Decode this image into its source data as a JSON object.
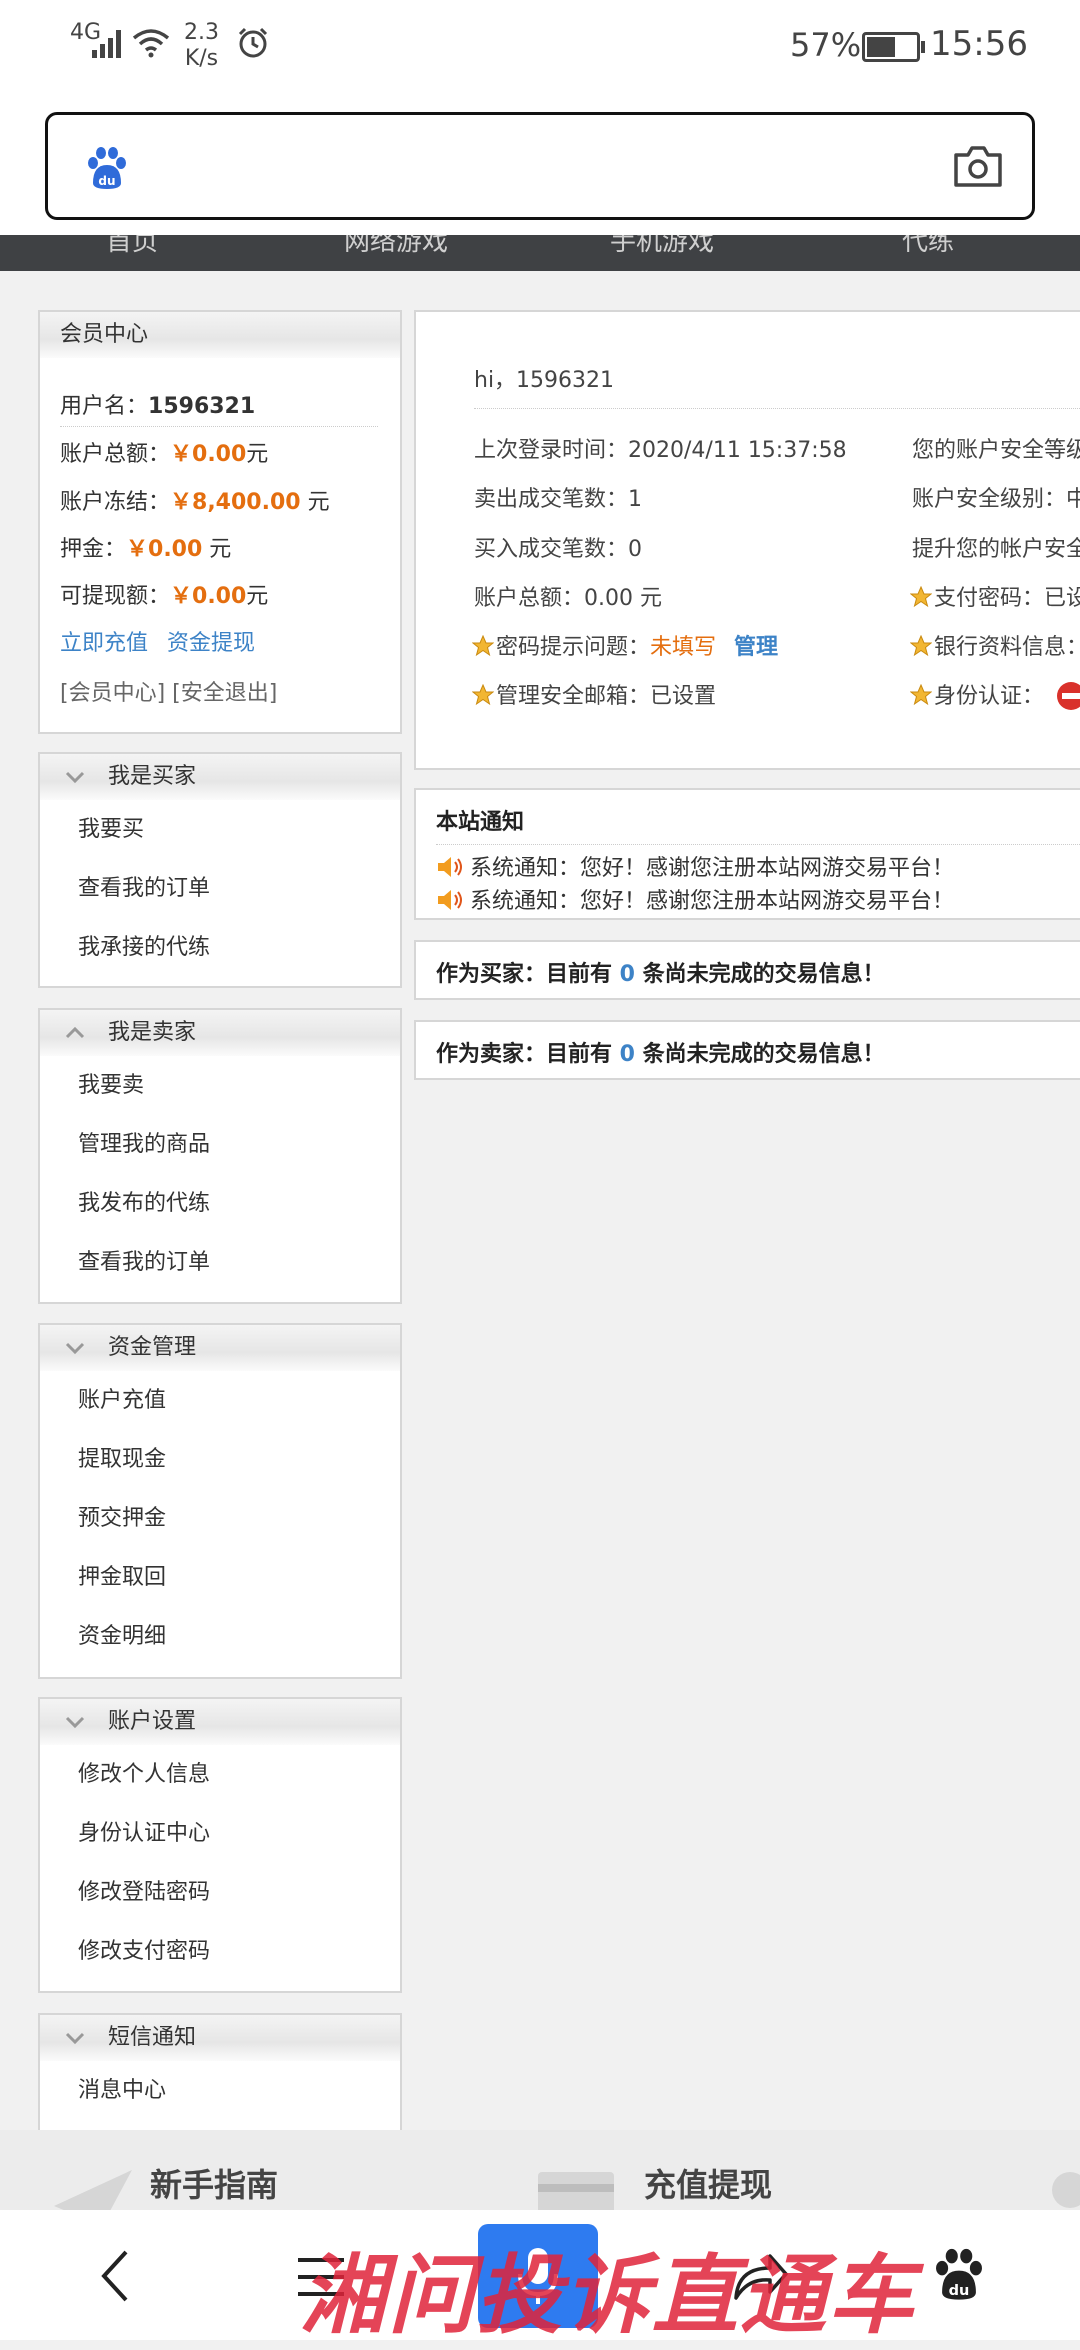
{
  "status_bar": {
    "signal": "4G",
    "speed_value": "2.3",
    "speed_unit": "K/s",
    "battery": "57%",
    "time": "15:56"
  },
  "search": {
    "placeholder": ""
  },
  "nav": {
    "items": [
      "首页",
      "网络游戏",
      "手机游戏",
      "代练"
    ]
  },
  "member_center": {
    "title": "会员中心",
    "username_label": "用户名：",
    "username": "1596321",
    "balance_label": "账户总额：",
    "balance": "￥0.00",
    "balance_unit": "元",
    "frozen_label": "账户冻结：",
    "frozen": "￥8,400.00",
    "frozen_unit": " 元",
    "deposit_label": "押金：",
    "deposit": "￥0.00",
    "deposit_unit": " 元",
    "withdrawable_label": "可提现额：",
    "withdrawable": "￥0.00",
    "withdrawable_unit": "元",
    "recharge_link": "立即充值",
    "withdraw_link": "资金提现",
    "center_link": "[会员中心]",
    "logout_link": "[安全退出]"
  },
  "menus": [
    {
      "title": "我是买家",
      "items": [
        "我要买",
        "查看我的订单",
        "我承接的代练"
      ]
    },
    {
      "title": "我是卖家",
      "items": [
        "我要卖",
        "管理我的商品",
        "我发布的代练",
        "查看我的订单"
      ]
    },
    {
      "title": "资金管理",
      "items": [
        "账户充值",
        "提取现金",
        "预交押金",
        "押金取回",
        "资金明细"
      ]
    },
    {
      "title": "账户设置",
      "items": [
        "修改个人信息",
        "身份认证中心",
        "修改登陆密码",
        "修改支付密码"
      ]
    },
    {
      "title": "短信通知",
      "items": [
        "消息中心"
      ]
    }
  ],
  "account_info": {
    "greeting": "hi，1596321",
    "last_login_label": "上次登录时间：",
    "last_login": "2020/4/11 15:37:58",
    "sold_label": "卖出成交笔数：",
    "sold": "1",
    "bought_label": "买入成交笔数：",
    "bought": "0",
    "total_label": "账户总额：",
    "total": "0.00 元",
    "pw_hint_label": "密码提示问题：",
    "pw_hint_value": "未填写",
    "pw_hint_manage": "管理",
    "email_label": "管理安全邮箱：",
    "email_value": "已设置",
    "security_level_text": "您的账户安全等级",
    "security_level_label": "账户安全级别：中",
    "improve_text": "提升您的帐户安全",
    "pay_pw": "支付密码：已设",
    "bank_info": "银行资料信息：",
    "id_auth": "身份认证："
  },
  "notice": {
    "title": "本站通知",
    "label": "系统通知：",
    "items": [
      "您好！感谢您注册本站网游交易平台！",
      "您好！感谢您注册本站网游交易平台！"
    ]
  },
  "buyer_info": {
    "prefix": "作为买家：目前有 ",
    "count": "0",
    "suffix": " 条尚未完成的交易信息！"
  },
  "seller_info": {
    "prefix": "作为卖家：目前有 ",
    "count": "0",
    "suffix": " 条尚未完成的交易信息！"
  },
  "footer": {
    "guide": "新手指南",
    "recharge": "充值提现"
  },
  "watermark": "湘问投诉直通车",
  "colors": {
    "orange": "#e46e0f",
    "link_blue": "#3d83c7",
    "nav_bg": "#3f4144",
    "mic_blue": "#2e7bf0"
  }
}
